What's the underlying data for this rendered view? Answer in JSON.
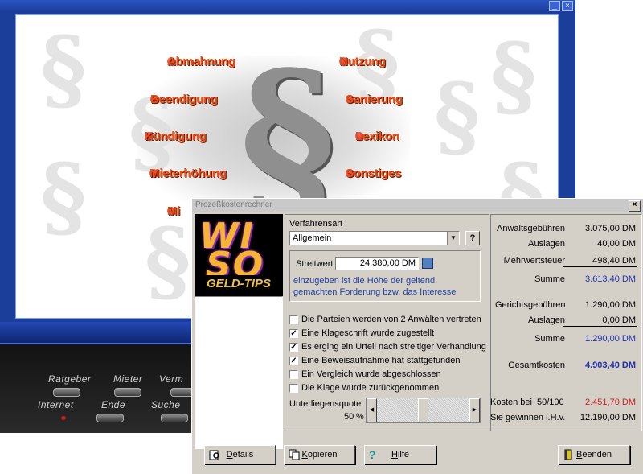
{
  "background_app": {
    "minimize_glyph": "_",
    "close_glyph": "×",
    "menu": {
      "left": [
        "Abmahnung",
        "Beendigung",
        "Kündigung",
        "Mieterhöhung",
        "Mi"
      ],
      "right": [
        "Nutzung",
        "Sanierung",
        "Lexikon",
        "Sonstiges"
      ]
    },
    "paragraph_glyph": "§",
    "device_labels": {
      "row1": [
        "Ratgeber",
        "Mieter",
        "Verm"
      ],
      "row2": [
        "Internet",
        "Ende",
        "Suche"
      ]
    }
  },
  "dialog": {
    "title": "Prozeßkostenrechner",
    "close_glyph": "×",
    "logo": {
      "letters_top": "WI",
      "letters_bottom": "SO",
      "caption": "GELD-TIPS"
    },
    "verfahrensart_label": "Verfahrensart",
    "verfahrensart_value": "Allgemein",
    "help_glyph": "?",
    "streitwert_label": "Streitwert",
    "streitwert_value": "24.380,00 DM",
    "streitwert_hint": "einzugeben ist die Höhe der geltend gemachten Forderung bzw. das Interesse",
    "checkboxes": [
      {
        "label": "Die Parteien werden von 2 Anwälten vertreten",
        "checked": false
      },
      {
        "label": "Eine Klageschrift wurde zugestellt",
        "checked": true
      },
      {
        "label": "Es erging ein Urteil nach streitiger Verhandlung",
        "checked": true
      },
      {
        "label": "Eine Beweisaufnahme hat stattgefunden",
        "checked": true
      },
      {
        "label": "Ein Vergleich wurde abgeschlossen",
        "checked": false
      },
      {
        "label": "Die Klage wurde zurückgenommen",
        "checked": false
      }
    ],
    "unterliegen_label": "Unterliegensquote",
    "unterliegen_value": "50",
    "unterliegen_unit": "%",
    "unterliegen_fraction": 0.5,
    "results": {
      "anwalt_label": "Anwaltsgebühren",
      "anwalt_value": "3.075,00 DM",
      "auslagen1_label": "Auslagen",
      "auslagen1_value": "40,00 DM",
      "mwst_label": "Mehrwertsteuer",
      "mwst_value": "498,40 DM",
      "summe1_label": "Summe",
      "summe1_value": "3.613,40 DM",
      "gericht_label": "Gerichtsgebühren",
      "gericht_value": "1.290,00 DM",
      "auslagen2_label": "Auslagen",
      "auslagen2_value": "0,00 DM",
      "summe2_label": "Summe",
      "summe2_value": "1.290,00 DM",
      "gesamt_label": "Gesamtkosten",
      "gesamt_value": "4.903,40 DM",
      "kosten_label": "Kosten bei",
      "kosten_ratio": "50/100",
      "kosten_value": "2.451,70 DM",
      "gewinn_label": "Sie gewinnen i.H.v.",
      "gewinn_value": "12.190,00 DM"
    },
    "buttons": {
      "details": "Details",
      "kopieren": "Kopieren",
      "hilfe": "Hilfe",
      "beenden": "Beenden"
    }
  },
  "colors": {
    "window_blue": "#1b3e9a",
    "menu_text": "#e8501a",
    "result_blue": "#2030b0",
    "result_red": "#d02020",
    "dialog_gray": "#d4d0c8"
  }
}
